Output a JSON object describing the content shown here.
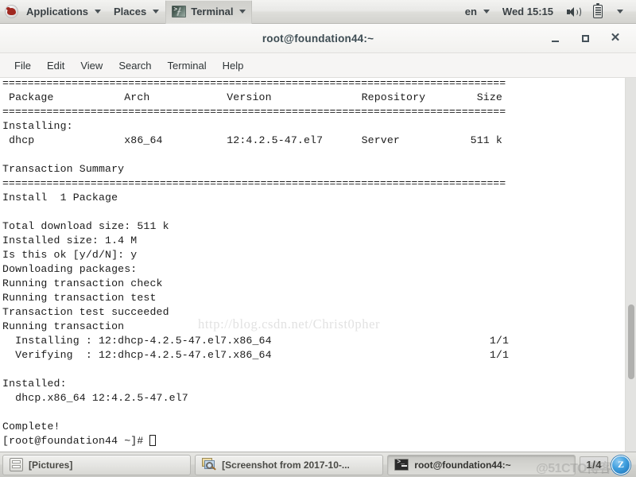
{
  "top_panel": {
    "logo": "redhat-logo",
    "applications_label": "Applications",
    "places_label": "Places",
    "active_app_label": "Terminal",
    "keyboard_layout": "en",
    "clock": "Wed 15:15",
    "volume_icon": "speaker-icon",
    "battery_icon": "battery-icon",
    "system_menu_icon": "chevron-down-icon"
  },
  "window": {
    "title": "root@foundation44:~",
    "minimize_label": "_",
    "maximize_label": "□",
    "close_label": "✕",
    "menu": [
      {
        "label": "File"
      },
      {
        "label": "Edit"
      },
      {
        "label": "View"
      },
      {
        "label": "Search"
      },
      {
        "label": "Terminal"
      },
      {
        "label": "Help"
      }
    ]
  },
  "terminal": {
    "watermark": "http://blog.csdn.net/Christ0pher",
    "lines": [
      "================================================================================",
      " Package           Arch            Version              Repository        Size",
      "================================================================================",
      "Installing:",
      " dhcp              x86_64          12:4.2.5-47.el7      Server           511 k",
      "",
      "Transaction Summary",
      "================================================================================",
      "Install  1 Package",
      "",
      "Total download size: 511 k",
      "Installed size: 1.4 M",
      "Is this ok [y/d/N]: y",
      "Downloading packages:",
      "Running transaction check",
      "Running transaction test",
      "Transaction test succeeded",
      "Running transaction",
      "  Installing : 12:dhcp-4.2.5-47.el7.x86_64                                  1/1",
      "  Verifying  : 12:dhcp-4.2.5-47.el7.x86_64                                  1/1",
      "",
      "Installed:",
      "  dhcp.x86_64 12:4.2.5-47.el7",
      "",
      "Complete!"
    ],
    "prompt": "[root@foundation44 ~]# ",
    "package_table": {
      "headers": [
        "Package",
        "Arch",
        "Version",
        "Repository",
        "Size"
      ],
      "rows": [
        [
          "dhcp",
          "x86_64",
          "12:4.2.5-47.el7",
          "Server",
          "511 k"
        ]
      ]
    },
    "summary": {
      "install_count_text": "Install  1 Package",
      "total_download_size": "511 k",
      "installed_size": "1.4 M",
      "confirm_prompt": "Is this ok [y/d/N]: y",
      "installed_package": "dhcp.x86_64 12:4.2.5-47.el7",
      "status": "Complete!"
    }
  },
  "taskbar": {
    "items": [
      {
        "icon": "file-drawer-icon",
        "label": "[Pictures]"
      },
      {
        "icon": "screenshot-icon",
        "label": "[Screenshot from 2017-10-..."
      },
      {
        "icon": "terminal-icon",
        "label": "root@foundation44:~"
      }
    ],
    "workspace_indicator": "1/4",
    "tray_icon_label": "Z",
    "watermark": "@51CTO博客"
  }
}
